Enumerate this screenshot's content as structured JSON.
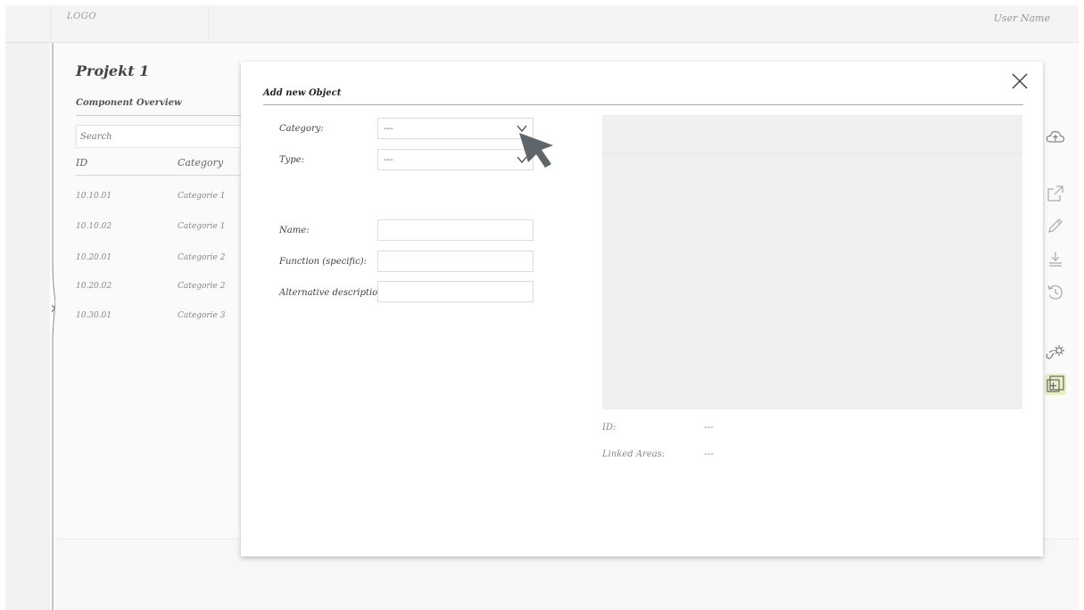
{
  "header": {
    "logo": "LOGO",
    "user_name": "User Name"
  },
  "sidebar": {
    "project_title": "Projekt 1",
    "section_label": "Component Overview",
    "search_placeholder": "Search",
    "columns": {
      "id": "ID",
      "category": "Category"
    },
    "rows": [
      {
        "id": "10.10.01",
        "category": "Categorie 1"
      },
      {
        "id": "10.10.02",
        "category": "Categorie 1"
      },
      {
        "id": "10.20.01",
        "category": "Categorie 2"
      },
      {
        "id": "10.20.02",
        "category": "Categorie 2"
      },
      {
        "id": "10.30.01",
        "category": "Categorie 3"
      }
    ]
  },
  "modal": {
    "title": "Add new Object",
    "category": {
      "label": "Category:",
      "value": "---"
    },
    "type": {
      "label": "Type:",
      "value": "---"
    },
    "name": {
      "label": "Name:",
      "value": ""
    },
    "function": {
      "label": "Function (specific):",
      "value": ""
    },
    "alt_description": {
      "label": "Alternative description:",
      "value": ""
    },
    "id_meta": {
      "label": "ID:",
      "value": "---"
    },
    "linked_meta": {
      "label": "Linked Areas:",
      "value": "---"
    }
  },
  "toolbar": {
    "icons": [
      "cloud-upload-icon",
      "external-link-icon",
      "edit-icon",
      "download-icon",
      "history-icon",
      "link-settings-icon",
      "add-object-icon"
    ]
  },
  "colors": {
    "accent": "#e7f0c5",
    "icon": "#999999",
    "cursor": "#5e666b"
  }
}
